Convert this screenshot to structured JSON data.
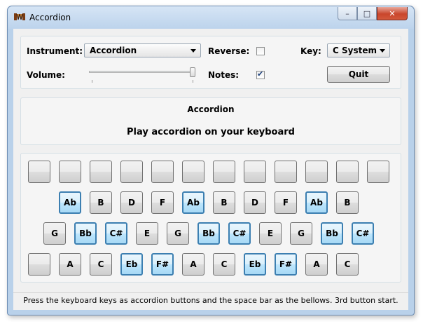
{
  "window": {
    "title": "Accordion",
    "icon": "accordion-icon",
    "close_label": "✕",
    "min_label": "–",
    "max_label": "□"
  },
  "controls": {
    "instrument_label": "Instrument:",
    "instrument_value": "Accordion",
    "reverse_label": "Reverse:",
    "reverse_checked": false,
    "key_label": "Key:",
    "key_value": "C System",
    "volume_label": "Volume:",
    "volume_level": 1.0,
    "notes_label": "Notes:",
    "notes_checked": true,
    "quit_label": "Quit"
  },
  "info": {
    "title": "Accordion",
    "subtitle": "Play accordion on your keyboard"
  },
  "keyboard": {
    "rows": [
      {
        "keys": [
          {
            "label": "",
            "hl": false
          },
          {
            "label": "",
            "hl": false
          },
          {
            "label": "",
            "hl": false
          },
          {
            "label": "",
            "hl": false
          },
          {
            "label": "",
            "hl": false
          },
          {
            "label": "",
            "hl": false
          },
          {
            "label": "",
            "hl": false
          },
          {
            "label": "",
            "hl": false
          },
          {
            "label": "",
            "hl": false
          },
          {
            "label": "",
            "hl": false
          },
          {
            "label": "",
            "hl": false
          },
          {
            "label": "",
            "hl": false
          }
        ]
      },
      {
        "keys": [
          {
            "label": "Ab",
            "hl": true
          },
          {
            "label": "B",
            "hl": false
          },
          {
            "label": "D",
            "hl": false
          },
          {
            "label": "F",
            "hl": false
          },
          {
            "label": "Ab",
            "hl": true
          },
          {
            "label": "B",
            "hl": false
          },
          {
            "label": "D",
            "hl": false
          },
          {
            "label": "F",
            "hl": false
          },
          {
            "label": "Ab",
            "hl": true
          },
          {
            "label": "B",
            "hl": false
          }
        ]
      },
      {
        "keys": [
          {
            "label": "G",
            "hl": false
          },
          {
            "label": "Bb",
            "hl": true
          },
          {
            "label": "C#",
            "hl": true
          },
          {
            "label": "E",
            "hl": false
          },
          {
            "label": "G",
            "hl": false
          },
          {
            "label": "Bb",
            "hl": true
          },
          {
            "label": "C#",
            "hl": true
          },
          {
            "label": "E",
            "hl": false
          },
          {
            "label": "G",
            "hl": false
          },
          {
            "label": "Bb",
            "hl": true
          },
          {
            "label": "C#",
            "hl": true
          }
        ]
      },
      {
        "keys": [
          {
            "label": "",
            "hl": false
          },
          {
            "label": "A",
            "hl": false
          },
          {
            "label": "C",
            "hl": false
          },
          {
            "label": "Eb",
            "hl": true
          },
          {
            "label": "F#",
            "hl": true
          },
          {
            "label": "A",
            "hl": false
          },
          {
            "label": "C",
            "hl": false
          },
          {
            "label": "Eb",
            "hl": true
          },
          {
            "label": "F#",
            "hl": true
          },
          {
            "label": "A",
            "hl": false
          },
          {
            "label": "C",
            "hl": false
          }
        ]
      }
    ]
  },
  "status": {
    "text": "Press the keyboard keys as accordion buttons and the space bar as the bellows. 3rd button start."
  }
}
